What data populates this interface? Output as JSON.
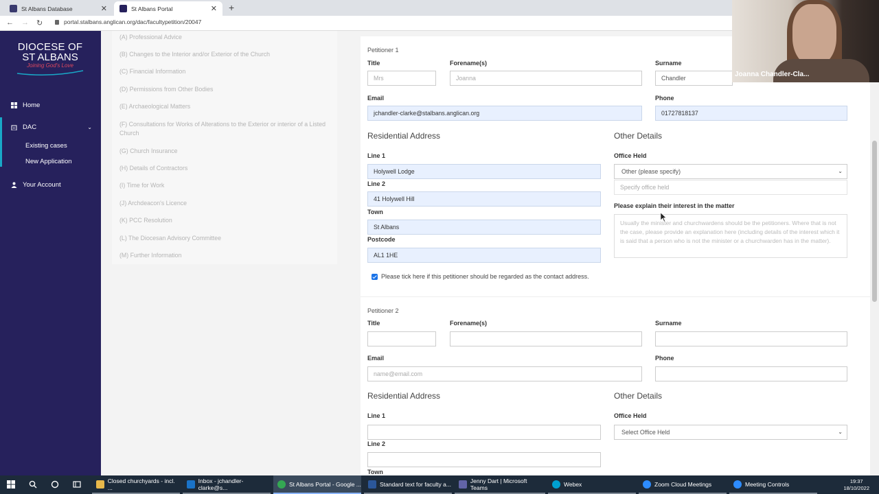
{
  "browser": {
    "tabs": [
      {
        "label": "St Albans Database",
        "active": false
      },
      {
        "label": "St Albans Portal",
        "active": true
      }
    ],
    "url": "portal.stalbans.anglican.org/dac/facultypetition/20047"
  },
  "logo": {
    "line1": "DIOCESE OF",
    "line2": "ST ALBANS",
    "tagline": "Joining God's Love"
  },
  "sidebar": {
    "home": "Home",
    "dac": "DAC",
    "existing_cases": "Existing cases",
    "new_application": "New Application",
    "your_account": "Your Account"
  },
  "sections": [
    "(A) Professional Advice",
    "(B) Changes to the Interior and/or Exterior of the Church",
    "(C) Financial Information",
    "(D) Permissions from Other Bodies",
    "(E) Archaeological Matters",
    "(F) Consultations for Works of Alterations to the Exterior or interior of a Listed Church",
    "(G) Church Insurance",
    "(H) Details of Contractors",
    "(I) Time for Work",
    "(J) Archdeacon's Licence",
    "(K) PCC Resolution",
    "(L) The Diocesan Advisory Committee",
    "(M) Further Information"
  ],
  "petitioner1": {
    "heading": "Petitioner 1",
    "title_label": "Title",
    "title_value": "Mrs",
    "forename_label": "Forename(s)",
    "forename_value": "Joanna",
    "surname_label": "Surname",
    "surname_value": "Chandler",
    "email_label": "Email",
    "email_value": "jchandler-clarke@stalbans.anglican.org",
    "phone_label": "Phone",
    "phone_value": "01727818137",
    "residential_heading": "Residential Address",
    "line1_label": "Line 1",
    "line1_value": "Holywell Lodge",
    "line2_label": "Line 2",
    "line2_value": "41 Holywell Hill",
    "town_label": "Town",
    "town_value": "St Albans",
    "postcode_label": "Postcode",
    "postcode_value": "AL1 1HE",
    "other_heading": "Other Details",
    "office_label": "Office Held",
    "office_value": "Other (please specify)",
    "specify_placeholder": "Specify office held",
    "interest_label": "Please explain their interest in the matter",
    "interest_placeholder": "Usually the minister and churchwardens should be the petitioners. Where that is not the case, please provide an explanation here (including details of the interest which it is said that a person who is not the minister or a churchwarden has in the matter).",
    "contact_checkbox_label": "Please tick here if this petitioner should be regarded as the contact address.",
    "contact_checked": true
  },
  "petitioner2": {
    "heading": "Petitioner 2",
    "title_label": "Title",
    "forename_label": "Forename(s)",
    "surname_label": "Surname",
    "email_label": "Email",
    "email_placeholder": "name@email.com",
    "phone_label": "Phone",
    "residential_heading": "Residential Address",
    "line1_label": "Line 1",
    "line2_label": "Line 2",
    "town_label": "Town",
    "other_heading": "Other Details",
    "office_label": "Office Held",
    "office_value": "Select Office Held"
  },
  "webcam": {
    "name": "Joanna Chandler-Cla..."
  },
  "taskbar": {
    "items": [
      {
        "label": "Closed churchyards - incl. ...",
        "color": "#e8b84a"
      },
      {
        "label": "Inbox - jchandler-clarke@s...",
        "color": "#1a73c8"
      },
      {
        "label": "St Albans Portal - Google ...",
        "color": "#34a853"
      },
      {
        "label": "Standard text for faculty a...",
        "color": "#2b579a"
      },
      {
        "label": "Jenny Dart | Microsoft Teams",
        "color": "#6264a7"
      },
      {
        "label": "Webex",
        "color": "#00a0d1"
      },
      {
        "label": "Zoom Cloud Meetings",
        "color": "#2d8cff"
      },
      {
        "label": "Meeting Controls",
        "color": "#2d8cff"
      }
    ],
    "time": "19:37",
    "date": "18/10/2022"
  }
}
